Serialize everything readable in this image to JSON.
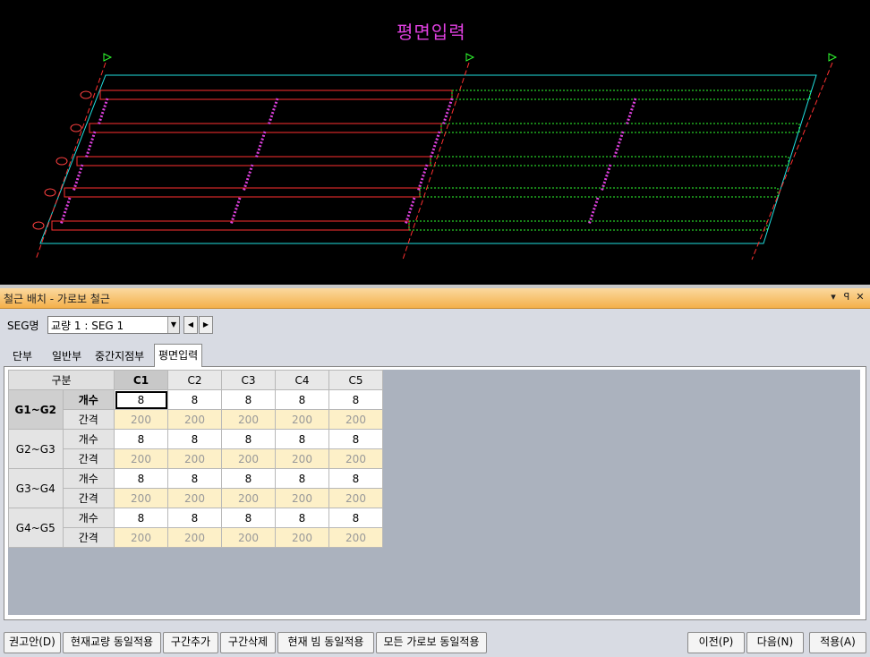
{
  "cad": {
    "title": "평면입력"
  },
  "panel": {
    "title": "철근 배치 - 가로보 철근",
    "icons": [
      "dropdown-arrow-icon",
      "pin-icon",
      "close-icon"
    ],
    "seg_label": "SEG명",
    "seg_value": "교량 1 : SEG 1"
  },
  "tabs": [
    "단부",
    "일반부",
    "중간지점부",
    "평면입력"
  ],
  "grid": {
    "corner": "구분",
    "columns": [
      "C1",
      "C2",
      "C3",
      "C4",
      "C5"
    ],
    "groups": [
      {
        "name": "G1~G2",
        "count_label": "개수",
        "gap_label": "간격",
        "counts": [
          "8",
          "8",
          "8",
          "8",
          "8"
        ],
        "gaps": [
          "200",
          "200",
          "200",
          "200",
          "200"
        ]
      },
      {
        "name": "G2~G3",
        "count_label": "개수",
        "gap_label": "간격",
        "counts": [
          "8",
          "8",
          "8",
          "8",
          "8"
        ],
        "gaps": [
          "200",
          "200",
          "200",
          "200",
          "200"
        ]
      },
      {
        "name": "G3~G4",
        "count_label": "개수",
        "gap_label": "간격",
        "counts": [
          "8",
          "8",
          "8",
          "8",
          "8"
        ],
        "gaps": [
          "200",
          "200",
          "200",
          "200",
          "200"
        ]
      },
      {
        "name": "G4~G5",
        "count_label": "개수",
        "gap_label": "간격",
        "counts": [
          "8",
          "8",
          "8",
          "8",
          "8"
        ],
        "gaps": [
          "200",
          "200",
          "200",
          "200",
          "200"
        ]
      }
    ]
  },
  "buttons": {
    "recommend": "권고안(D)",
    "apply_current_bridge": "현재교량 동일적용",
    "add_section": "구간추가",
    "delete_section": "구간삭제",
    "apply_current_beam": "현재 빔 동일적용",
    "apply_all_crossbeams": "모든 가로보 동일적용",
    "prev": "이전(P)",
    "next": "다음(N)",
    "apply": "적용(A)"
  }
}
